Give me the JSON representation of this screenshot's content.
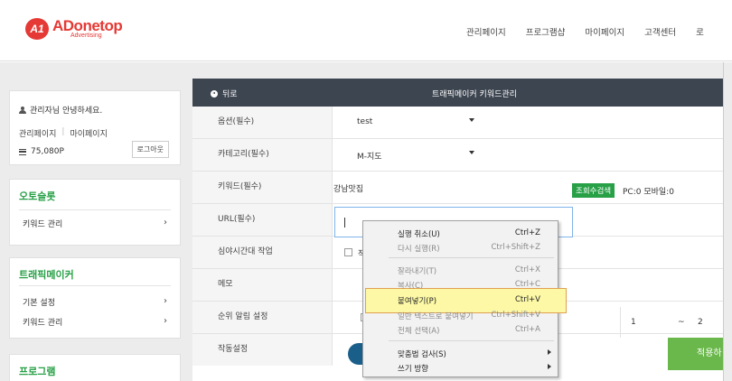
{
  "logo": {
    "badge": "A1",
    "name": "ADonetop",
    "sub": "Advertising"
  },
  "topnav": [
    "관리페이지",
    "프로그램샵",
    "마이페이지",
    "고객센터",
    "로"
  ],
  "user_card": {
    "greeting": "관리자님 안녕하세요.",
    "link_manage": "관리페이지",
    "link_sep": "|",
    "link_mypage": "마이페이지",
    "points": "75,080P",
    "logout": "로그아웃"
  },
  "auto_card": {
    "title": "오토슬롯",
    "items": [
      "키워드 관리"
    ]
  },
  "traffic_card": {
    "title": "트래픽메이커",
    "items": [
      "기본 설정",
      "키워드 관리"
    ]
  },
  "program_card": {
    "title": "프로그램"
  },
  "main": {
    "back": "뒤로",
    "title": "트래픽메이커 키워드관리",
    "rows": {
      "option": {
        "label": "옵션(필수)",
        "value": "test"
      },
      "category": {
        "label": "카테고리(필수)",
        "value": "M-지도"
      },
      "keyword": {
        "label": "키워드(필수)",
        "value": "강남맛집",
        "badge": "조회수검색",
        "pc_mobile": "PC:0 모바일:0"
      },
      "url": {
        "label": "URL(필수)"
      },
      "night": {
        "label": "심야시간대 작업",
        "check_label": "작업"
      },
      "memo": {
        "label": "메모"
      },
      "rank_alert": {
        "label": "순위 알림 설정",
        "from": "1",
        "tilde": "~",
        "to": "2"
      },
      "run": {
        "label": "작동설정"
      }
    },
    "apply": "적용하"
  },
  "context_menu": [
    {
      "label": "실행 취소(U)",
      "shortcut": "Ctrl+Z",
      "enabled": true
    },
    {
      "label": "다시 실행(R)",
      "shortcut": "Ctrl+Shift+Z",
      "enabled": false
    },
    {
      "label": "잘라내기(T)",
      "shortcut": "Ctrl+X",
      "enabled": false
    },
    {
      "label": "복사(C)",
      "shortcut": "Ctrl+C",
      "enabled": false
    },
    {
      "label": "붙여넣기(P)",
      "shortcut": "Ctrl+V",
      "enabled": true
    },
    {
      "label": "일반 텍스트로 붙여넣기",
      "shortcut": "Ctrl+Shift+V",
      "enabled": false
    },
    {
      "label": "전체 선택(A)",
      "shortcut": "Ctrl+A",
      "enabled": false
    },
    {
      "label": "맞춤법 검사(S)",
      "shortcut": "",
      "enabled": true
    },
    {
      "label": "쓰기 방향",
      "shortcut": "",
      "enabled": true
    }
  ],
  "colors": {
    "brand": "#e53935",
    "green": "#27a046",
    "header_dark": "#3d4550",
    "apply_green": "#6ab84b",
    "highlight": "#fcf8a6"
  }
}
